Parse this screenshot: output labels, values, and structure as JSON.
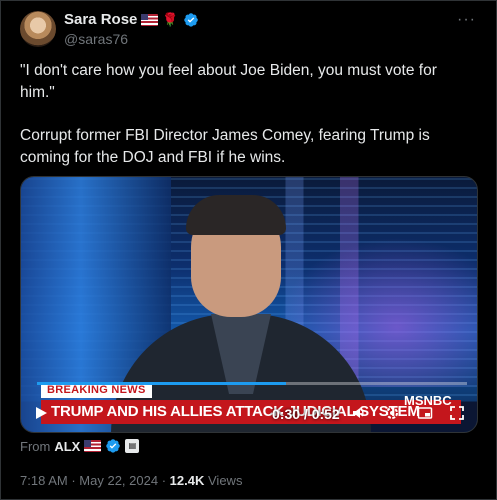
{
  "author": {
    "display_name": "Sara Rose",
    "handle": "@saras76"
  },
  "tweet": {
    "paragraphs": [
      "\"I don't care how you feel about Joe Biden, you must vote for him.\"",
      "Corrupt former FBI Director James Comey, fearing Trump is coming for the DOJ and FBI if he wins."
    ]
  },
  "video": {
    "breaking_label": "BREAKING NEWS",
    "headline": "TRUMP AND HIS ALLIES ATTACK JUDICIAL SYSTEM",
    "network": "MSNBC",
    "time_display": "0:30 / 0:52",
    "progress_fraction": 0.58
  },
  "source": {
    "prefix": "From",
    "name": "ALX"
  },
  "meta": {
    "time": "7:18 AM",
    "separator": "·",
    "date": "May 22, 2024",
    "views_count": "12.4K",
    "views_label": "Views"
  },
  "colors": {
    "accent": "#1d9bf0",
    "headline_red": "#c4161c",
    "background": "#000000"
  },
  "icons": [
    "more-icon",
    "verified-icon",
    "flag-icon",
    "rose-icon",
    "play-icon",
    "volume-icon",
    "settings-icon",
    "fullscreen-icon"
  ]
}
